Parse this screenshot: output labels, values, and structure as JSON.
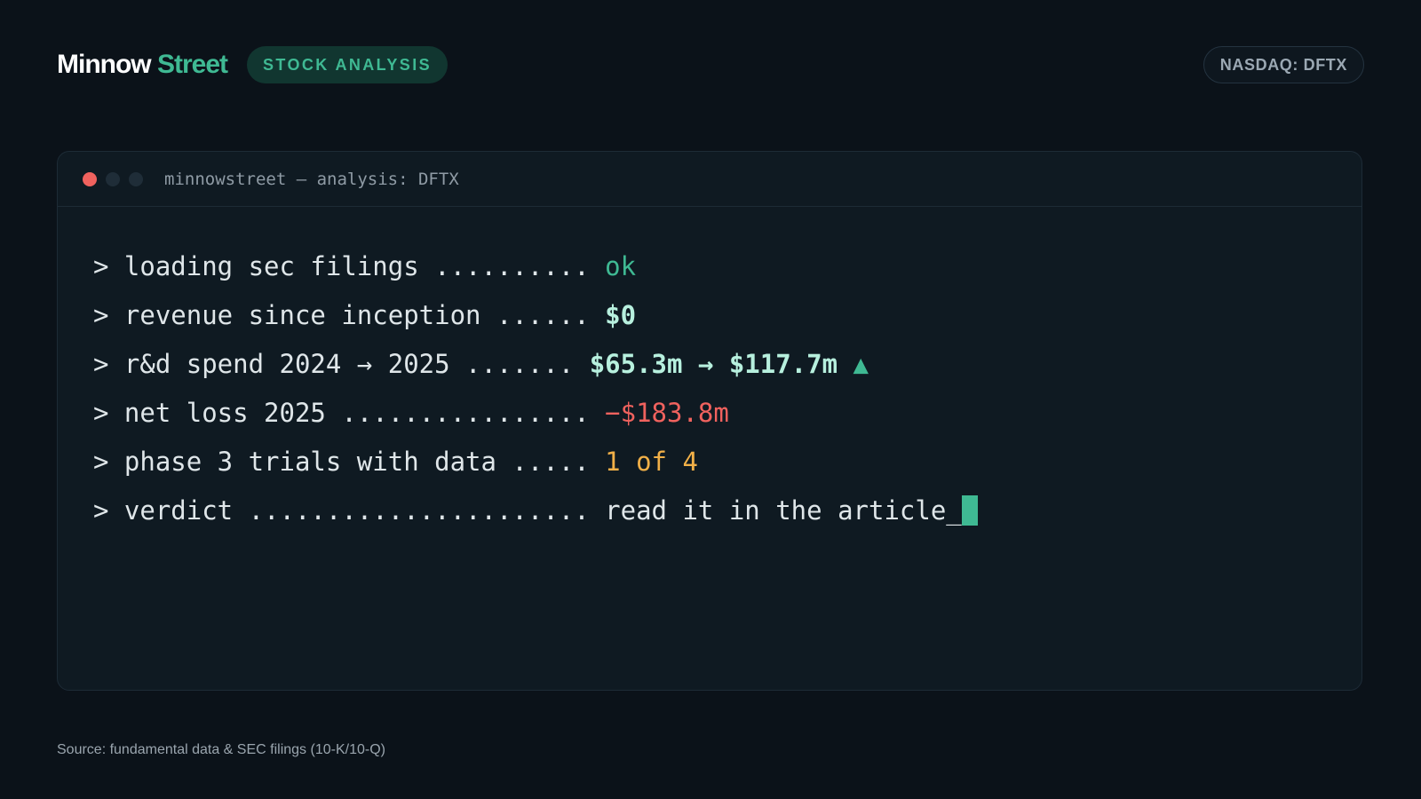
{
  "header": {
    "brand_part1": "Minnow",
    "brand_part2": "Street",
    "tag": "STOCK ANALYSIS",
    "ticker": "NASDAQ: DFTX"
  },
  "terminal": {
    "title": "minnowstreet — analysis: DFTX",
    "window_dots": [
      "#f0625e",
      "#1f2d38",
      "#1f2d38"
    ],
    "lines": [
      {
        "label": "> loading sec filings .......... ",
        "value": "ok"
      },
      {
        "label": "> revenue since inception ...... ",
        "value": "$0"
      },
      {
        "label": "> r&d spend 2024 → 2025 ....... ",
        "value": "$65.3m → $117.7m",
        "indicator": "▲"
      },
      {
        "label": "> net loss 2025 ................ ",
        "value": "−$183.8m"
      },
      {
        "label": "> phase 3 trials with data ..... ",
        "value": "1 of 4"
      },
      {
        "label": "> verdict ...................... ",
        "value": "read it in the article_"
      }
    ]
  },
  "footer": {
    "source": "Source: fundamental data & SEC filings (10-K/10-Q)"
  },
  "colors": {
    "background": "#0b1219",
    "accent": "#3fb993",
    "negative": "#f0625e",
    "warning": "#f1b048",
    "highlight": "#b7f0de"
  }
}
